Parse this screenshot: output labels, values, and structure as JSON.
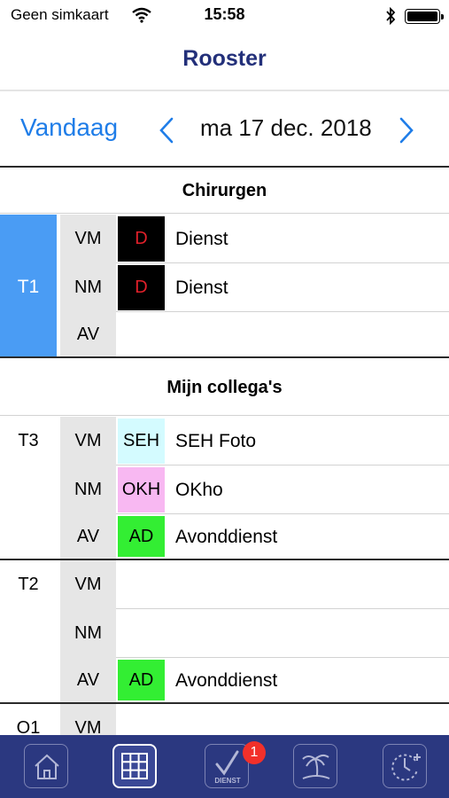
{
  "status": {
    "carrier": "Geen simkaart",
    "time": "15:58"
  },
  "nav": {
    "title": "Rooster"
  },
  "datebar": {
    "today": "Vandaag",
    "date": "ma 17 dec. 2018"
  },
  "sections": {
    "surgeons": "Chirurgen",
    "colleagues": "Mijn collega's"
  },
  "people": {
    "t1": "T1",
    "t3": "T3",
    "t2": "T2",
    "o1": "O1"
  },
  "rows": [
    {
      "period": "VM",
      "code": "D",
      "desc": "Dienst",
      "code_bg": "#000000",
      "code_color": "#e0202a"
    },
    {
      "period": "NM",
      "code": "D",
      "desc": "Dienst",
      "code_bg": "#000000",
      "code_color": "#e0202a"
    },
    {
      "period": "AV",
      "code": "",
      "desc": ""
    },
    {
      "period": "VM",
      "code": "SEH",
      "desc": "SEH Foto",
      "code_bg": "#d4fbff",
      "code_color": "#000000"
    },
    {
      "period": "NM",
      "code": "OKH",
      "desc": "OKho",
      "code_bg": "#f8b8f2",
      "code_color": "#000000"
    },
    {
      "period": "AV",
      "code": "AD",
      "desc": "Avonddienst",
      "code_bg": "#33ee33",
      "code_color": "#000000"
    },
    {
      "period": "VM",
      "code": "",
      "desc": ""
    },
    {
      "period": "NM",
      "code": "",
      "desc": ""
    },
    {
      "period": "AV",
      "code": "AD",
      "desc": "Avonddienst",
      "code_bg": "#33ee33",
      "code_color": "#000000"
    },
    {
      "period": "VM",
      "code": "",
      "desc": ""
    }
  ],
  "tabbar": {
    "tabs": [
      {
        "name": "home",
        "icon": "home-icon"
      },
      {
        "name": "rooster",
        "icon": "grid-icon",
        "active": true
      },
      {
        "name": "dienst",
        "icon": "checkmark-dienst-icon",
        "label": "DIENST",
        "badge": "1"
      },
      {
        "name": "vakantie",
        "icon": "palm-tree-icon"
      },
      {
        "name": "uren",
        "icon": "clock-plus-icon"
      }
    ]
  },
  "colors": {
    "accent": "#1f7de8",
    "title": "#23307a",
    "tabbar": "#2b3880",
    "t1": "#4a9cf4",
    "badge": "#f2302a"
  }
}
